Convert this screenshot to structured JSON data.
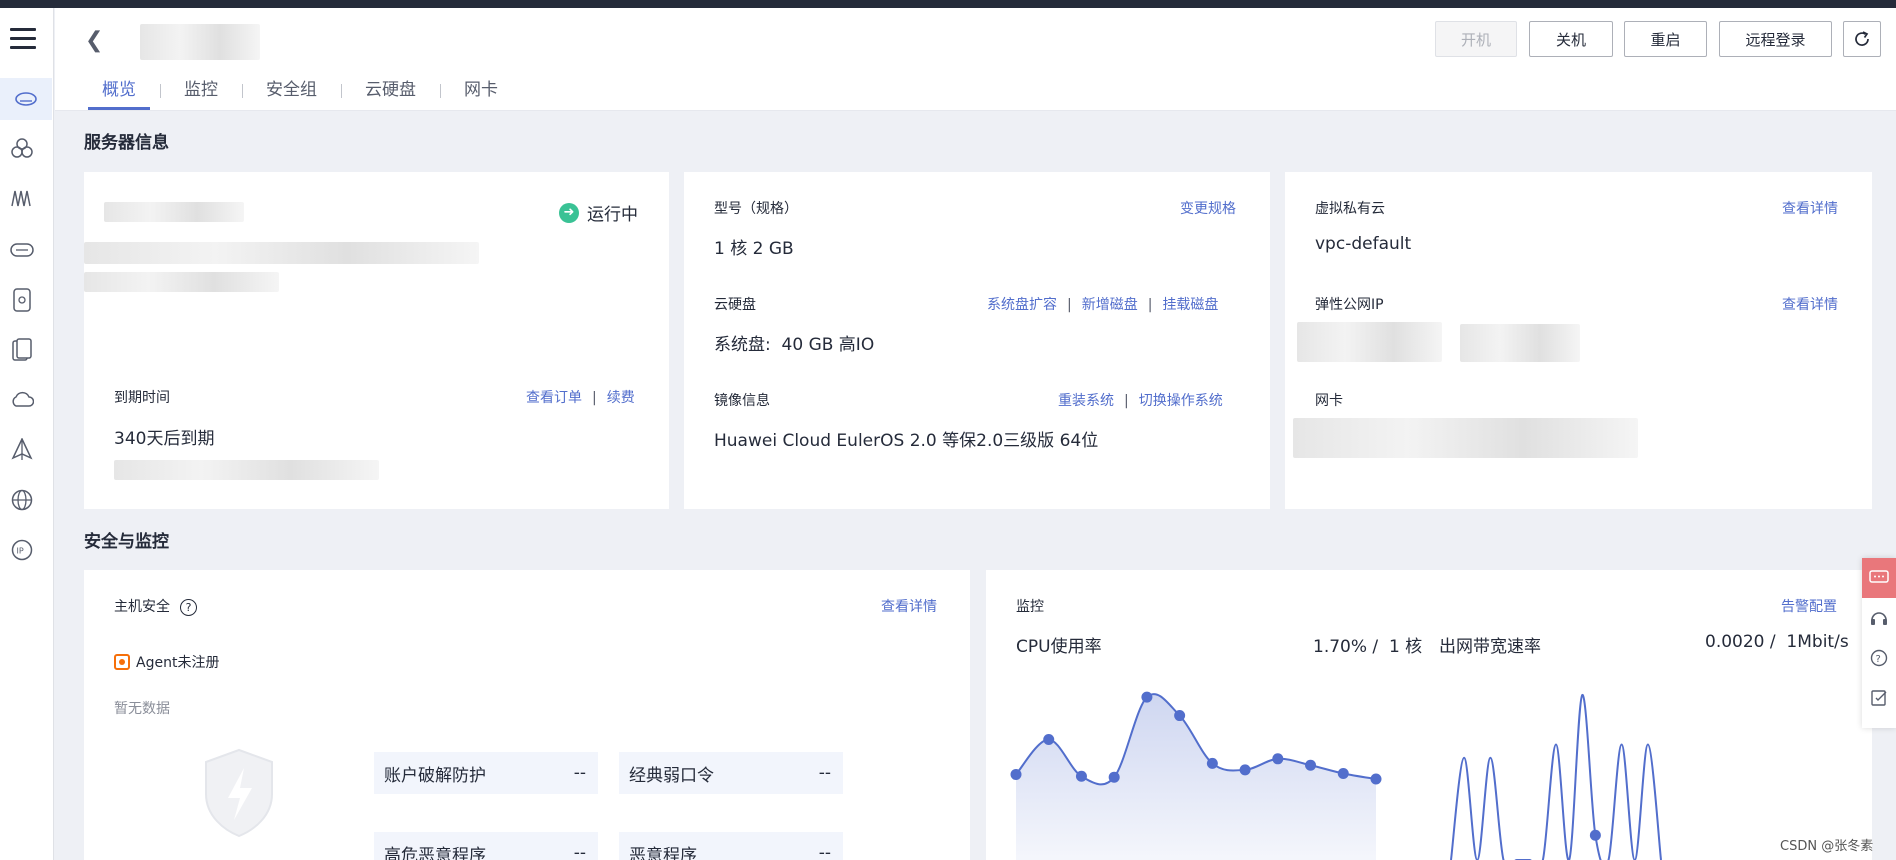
{
  "header": {
    "buttons": {
      "start": "开机",
      "shutdown": "关机",
      "restart": "重启",
      "remote_login": "远程登录"
    },
    "tabs": [
      "概览",
      "监控",
      "安全组",
      "云硬盘",
      "网卡"
    ]
  },
  "server_info": {
    "title": "服务器信息",
    "status": "运行中",
    "expiry_label": "到期时间",
    "view_order": "查看订单",
    "renew": "续费",
    "expiry_value": "340天后到期",
    "spec_label": "型号（规格）",
    "change_spec": "变更规格",
    "spec_value": "1 核 2 GB",
    "disk_label": "云硬盘",
    "disk_expand": "系统盘扩容",
    "disk_add": "新增磁盘",
    "disk_mount": "挂载磁盘",
    "disk_value": "系统盘:  40 GB 高IO",
    "image_label": "镜像信息",
    "reinstall": "重装系统",
    "switch_os": "切换操作系统",
    "image_value": "Huawei Cloud EulerOS 2.0 等保2.0三级版 64位",
    "vpc_label": "虚拟私有云",
    "vpc_detail": "查看详情",
    "vpc_value": "vpc-default",
    "eip_label": "弹性公网IP",
    "eip_detail": "查看详情",
    "nic_label": "网卡"
  },
  "security": {
    "title": "安全与监控",
    "host_security": "主机安全",
    "view_detail": "查看详情",
    "agent": "Agent未注册",
    "no_data": "暂无数据",
    "items": [
      {
        "label": "账户破解防护",
        "value": "--"
      },
      {
        "label": "经典弱口令",
        "value": "--"
      },
      {
        "label": "高危恶意程序",
        "value": "--"
      },
      {
        "label": "恶意程序",
        "value": "--"
      }
    ]
  },
  "monitor": {
    "label": "监控",
    "alarm_config": "告警配置",
    "cpu_label": "CPU使用率",
    "cpu_value": "1.70% /  1 核",
    "bw_label": "出网带宽速率",
    "bw_value": "0.0020 /  1Mbit/s"
  },
  "chart_data": [
    {
      "type": "area",
      "series": [
        {
          "values": [
            0.93,
            1.31,
            0.91,
            0.9,
            1.77,
            1.57,
            1.05,
            0.98,
            1.1,
            1.03,
            0.94,
            0.88
          ]
        }
      ],
      "color": "#526ecc"
    },
    {
      "type": "line",
      "series": [
        {
          "values": [
            0,
            0.62,
            0,
            0.62,
            0,
            0,
            0,
            0,
            0.7,
            0,
            1.0,
            0.15,
            0,
            0.7,
            0,
            0.7,
            0
          ]
        }
      ],
      "color": "#526ecc"
    }
  ],
  "watermark": "CSDN @张冬素"
}
